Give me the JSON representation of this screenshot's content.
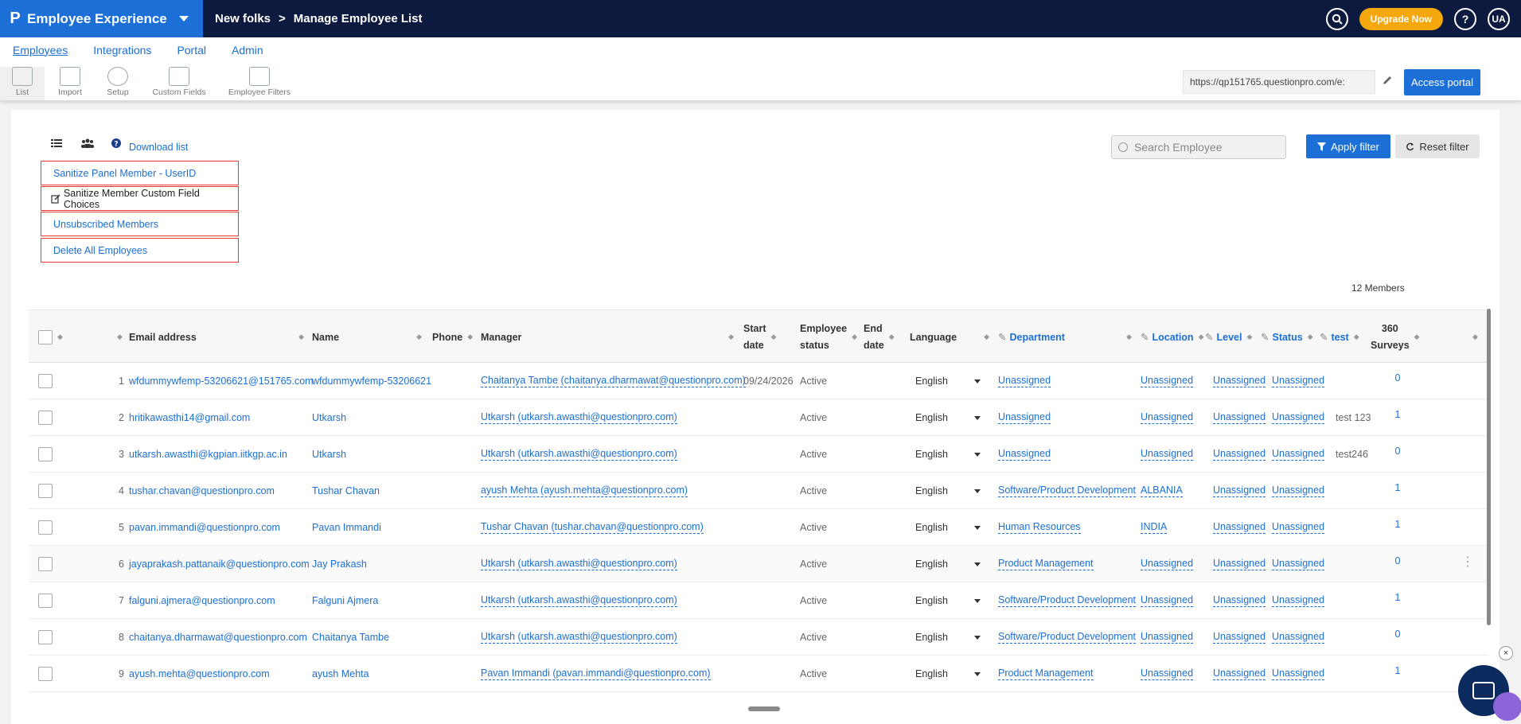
{
  "app": {
    "title": "Employee Experience",
    "logo": "P"
  },
  "breadcrumb": {
    "parent": "New folks",
    "separator": ">",
    "current": "Manage Employee List"
  },
  "topbar": {
    "upgrade_label": "Upgrade Now",
    "help": "?",
    "avatar": "UA"
  },
  "nav": [
    {
      "label": "Employees",
      "active": true
    },
    {
      "label": "Integrations",
      "active": false
    },
    {
      "label": "Portal",
      "active": false
    },
    {
      "label": "Admin",
      "active": false
    }
  ],
  "toolbar": {
    "tools": [
      {
        "label": "List",
        "icon": "list-icon"
      },
      {
        "label": "Import",
        "icon": "import-user-icon"
      },
      {
        "label": "Setup",
        "icon": "gear-icon"
      },
      {
        "label": "Custom Fields",
        "icon": "custom-fields-icon"
      },
      {
        "label": "Employee Filters",
        "icon": "chart-filter-icon"
      }
    ],
    "portal_url": "https://qp151765.questionpro.com/e:",
    "access_label": "Access portal"
  },
  "actions": {
    "download_label": "Download list",
    "buttons": [
      "Sanitize Panel Member - UserID",
      "Sanitize Member Custom Field Choices",
      "Unsubscribed Members",
      "Delete All Employees"
    ]
  },
  "search": {
    "placeholder": "Search Employee"
  },
  "filters": {
    "apply_label": "Apply filter",
    "reset_label": "Reset filter"
  },
  "member_count": "12 Members",
  "columns": {
    "email": "Email address",
    "name": "Name",
    "phone": "Phone",
    "manager": "Manager",
    "start1": "Start",
    "start2": "date",
    "status1": "Employee",
    "status2": "status",
    "end1": "End",
    "end2": "date",
    "language": "Language",
    "department": "Department",
    "location": "Location",
    "level": "Level",
    "status": "Status",
    "test": "test",
    "surveys1": "360",
    "surveys2": "Surveys"
  },
  "rows": [
    {
      "n": "1",
      "email": "wfdummywfemp-53206621@151765.com",
      "name": "wfdummywfemp-53206621",
      "manager": "Chaitanya Tambe (chaitanya.dharmawat@questionpro.com)",
      "start": "09/24/2026",
      "estatus": "Active",
      "lang": "English",
      "dept": "Unassigned",
      "loc": "Unassigned",
      "level": "Unassigned",
      "status": "Unassigned",
      "test": "",
      "surveys": "0"
    },
    {
      "n": "2",
      "email": "hritikawasthi14@gmail.com",
      "name": "Utkarsh",
      "manager": "Utkarsh (utkarsh.awasthi@questionpro.com)",
      "start": "",
      "estatus": "Active",
      "lang": "English",
      "dept": "Unassigned",
      "loc": "Unassigned",
      "level": "Unassigned",
      "status": "Unassigned",
      "test": "test 123",
      "surveys": "1"
    },
    {
      "n": "3",
      "email": "utkarsh.awasthi@kgpian.iitkgp.ac.in",
      "name": "Utkarsh",
      "manager": "Utkarsh (utkarsh.awasthi@questionpro.com)",
      "start": "",
      "estatus": "Active",
      "lang": "English",
      "dept": "Unassigned",
      "loc": "Unassigned",
      "level": "Unassigned",
      "status": "Unassigned",
      "test": "test246",
      "surveys": "0"
    },
    {
      "n": "4",
      "email": "tushar.chavan@questionpro.com",
      "name": "Tushar Chavan",
      "manager": "ayush Mehta (ayush.mehta@questionpro.com)",
      "start": "",
      "estatus": "Active",
      "lang": "English",
      "dept": "Software/Product Development",
      "loc": "ALBANIA",
      "level": "Unassigned",
      "status": "Unassigned",
      "test": "",
      "surveys": "1"
    },
    {
      "n": "5",
      "email": "pavan.immandi@questionpro.com",
      "name": "Pavan Immandi",
      "manager": "Tushar Chavan (tushar.chavan@questionpro.com)",
      "start": "",
      "estatus": "Active",
      "lang": "English",
      "dept": "Human Resources",
      "loc": "INDIA",
      "level": "Unassigned",
      "status": "Unassigned",
      "test": "",
      "surveys": "1"
    },
    {
      "n": "6",
      "email": "jayaprakash.pattanaik@questionpro.com",
      "name": "Jay Prakash",
      "manager": "Utkarsh (utkarsh.awasthi@questionpro.com)",
      "start": "",
      "estatus": "Active",
      "lang": "English",
      "dept": "Product Management",
      "loc": "Unassigned",
      "level": "Unassigned",
      "status": "Unassigned",
      "test": "",
      "surveys": "0"
    },
    {
      "n": "7",
      "email": "falguni.ajmera@questionpro.com",
      "name": "Falguni Ajmera",
      "manager": "Utkarsh (utkarsh.awasthi@questionpro.com)",
      "start": "",
      "estatus": "Active",
      "lang": "English",
      "dept": "Software/Product Development",
      "loc": "Unassigned",
      "level": "Unassigned",
      "status": "Unassigned",
      "test": "",
      "surveys": "1"
    },
    {
      "n": "8",
      "email": "chaitanya.dharmawat@questionpro.com",
      "name": "Chaitanya Tambe",
      "manager": "Utkarsh (utkarsh.awasthi@questionpro.com)",
      "start": "",
      "estatus": "Active",
      "lang": "English",
      "dept": "Software/Product Development",
      "loc": "Unassigned",
      "level": "Unassigned",
      "status": "Unassigned",
      "test": "",
      "surveys": "0"
    },
    {
      "n": "9",
      "email": "ayush.mehta@questionpro.com",
      "name": "ayush Mehta",
      "manager": "Pavan Immandi (pavan.immandi@questionpro.com)",
      "start": "",
      "estatus": "Active",
      "lang": "English",
      "dept": "Product Management",
      "loc": "Unassigned",
      "level": "Unassigned",
      "status": "Unassigned",
      "test": "",
      "surveys": "1"
    }
  ]
}
